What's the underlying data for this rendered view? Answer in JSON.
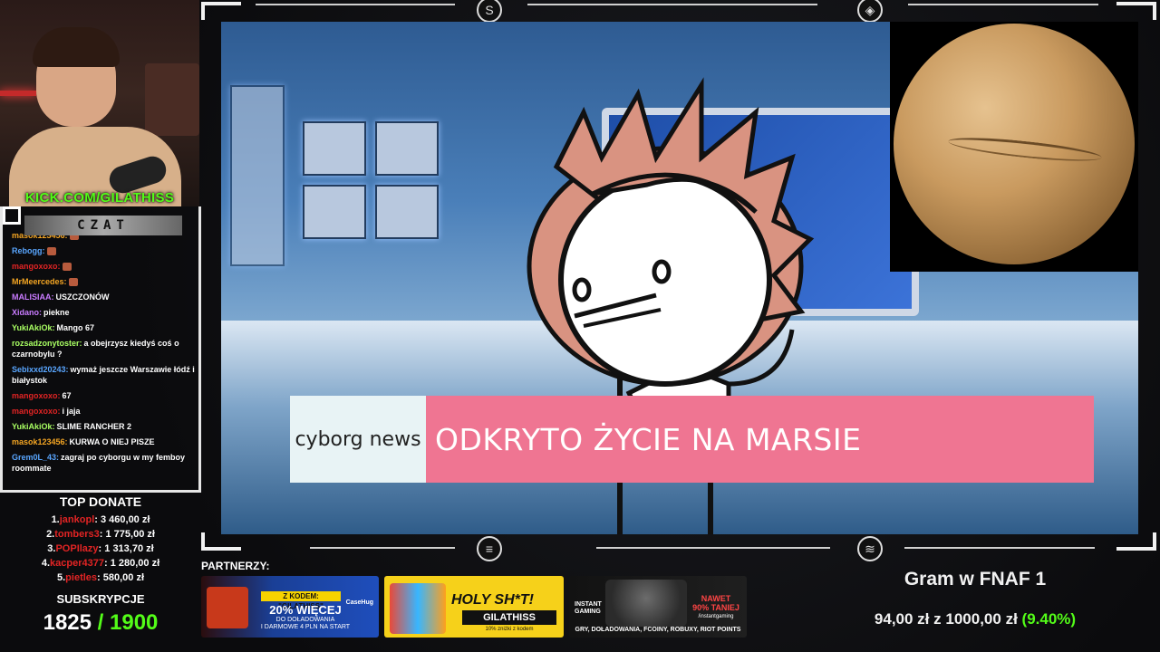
{
  "webcam": {
    "channel_label": "KICK.COM/GILATHISS"
  },
  "chat": {
    "header": "CZAT",
    "messages": [
      {
        "user": "masok123456:",
        "user_color": "#f5a623",
        "text": "",
        "emote": true
      },
      {
        "user": "Rebogg:",
        "user_color": "#59a6ff",
        "text": "",
        "emote": true
      },
      {
        "user": "mangoxoxo:",
        "user_color": "#e22424",
        "text": "",
        "emote": true
      },
      {
        "user": "MrMeercedes:",
        "user_color": "#f5a623",
        "text": "",
        "emote": true
      },
      {
        "user": "MALISIAA:",
        "user_color": "#c97bff",
        "text": "USZCZONÓW",
        "emote": false
      },
      {
        "user": "Xidano:",
        "user_color": "#c97bff",
        "text": "piekne",
        "emote": false
      },
      {
        "user": "YukiAkiOk:",
        "user_color": "#a9ff63",
        "text": "Mango 67",
        "emote": false
      },
      {
        "user": "rozsadzonytoster:",
        "user_color": "#a9ff63",
        "text": "a obejrzysz kiedyś coś o czarnobylu ?",
        "emote": false
      },
      {
        "user": "Sebixxd20243:",
        "user_color": "#59a6ff",
        "text": "wymaż jeszcze Warszawie łódź i białystok",
        "emote": false
      },
      {
        "user": "mangoxoxo:",
        "user_color": "#e22424",
        "text": "67",
        "emote": false
      },
      {
        "user": "mangoxoxo:",
        "user_color": "#e22424",
        "text": "i jaja",
        "emote": false
      },
      {
        "user": "YukiAkiOk:",
        "user_color": "#a9ff63",
        "text": "SLIME RANCHER 2",
        "emote": false
      },
      {
        "user": "masok123456:",
        "user_color": "#f5a623",
        "text": "KURWA O NIEJ PISZE",
        "emote": false
      },
      {
        "user": "Grem0L_43:",
        "user_color": "#59a6ff",
        "text": "zagraj po cyborgu w my femboy roommate",
        "emote": false
      }
    ]
  },
  "top_donate": {
    "title": "TOP DONATE",
    "donors": [
      {
        "rank": "1.",
        "name": "jankopl",
        "amount": ": 3 460,00 zł"
      },
      {
        "rank": "2.",
        "name": "tombers3",
        "amount": ": 1 775,00 zł"
      },
      {
        "rank": "3.",
        "name": "POPIlazy",
        "amount": ": 1 313,70 zł"
      },
      {
        "rank": "4.",
        "name": "kacper4377",
        "amount": ": 1 280,00 zł"
      },
      {
        "rank": "5.",
        "name": "pietles",
        "amount": ": 580,00 zł"
      }
    ]
  },
  "subs": {
    "title": "SUBSKRYPCJE",
    "current": "1825",
    "goal": "/ 1900"
  },
  "video": {
    "lower_third_left": "cyborg news",
    "lower_third_right": "ODKRYTO ŻYCIE NA MARSIE"
  },
  "partners": {
    "title": "PARTNERZY:",
    "p1": {
      "tag": "Z KODEM: \"GILATHISS\"",
      "big": "20% WIĘCEJ",
      "line1": "DO DOŁADOWANIA",
      "line2": "I DARMOWE 4 PLN NA START",
      "brand": "CaseHug"
    },
    "p2": {
      "big": "HOLY SH*T!",
      "code": "GILATHISS",
      "small": "10% zniżki z kodem"
    },
    "p3": {
      "logo1": "INSTANT",
      "logo2": "GAMING",
      "promo1": "NAWET",
      "promo2": "90% TANIEJ",
      "ig": "/instantgaming",
      "bottom": "GRY, DOŁADOWANIA, FCOINY, ROBUXY, RIOT POINTS"
    }
  },
  "goal": {
    "title": "Gram w FNAF 1",
    "amount": "94,00 zł",
    "sep": "z",
    "target": "1000,00 zł",
    "percent": "(9.40%)"
  },
  "colors": {
    "kick_green": "#53fc18",
    "lower_third_pink": "#ef7592",
    "lower_third_light": "#e8f3f5",
    "donor_red": "#e22424"
  }
}
